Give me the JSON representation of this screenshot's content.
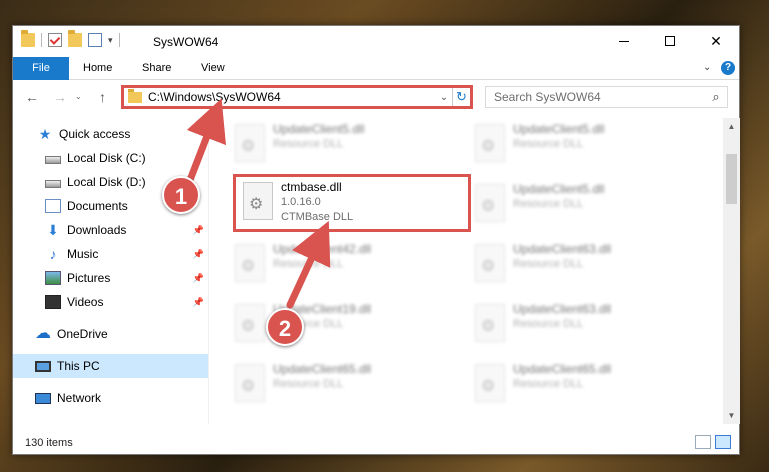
{
  "window": {
    "title": "SysWOW64",
    "qat_caret": "▾",
    "minimize": "",
    "maximize": "",
    "close": "✕"
  },
  "ribbon": {
    "tabs": [
      "File",
      "Home",
      "Share",
      "View"
    ],
    "expand": "⌄",
    "help": "?"
  },
  "nav": {
    "back": "←",
    "forward": "→",
    "recent": "⌄",
    "up": "↑",
    "address": "C:\\Windows\\SysWOW64",
    "address_dropdown": "⌄",
    "refresh": "↻",
    "search_placeholder": "Search SysWOW64",
    "search_icon": "⌕"
  },
  "sidebar": {
    "items": [
      {
        "label": "Quick access",
        "icon": "star-icon",
        "pinned": false
      },
      {
        "label": "Local Disk (C:)",
        "icon": "disk-icon",
        "pinned": false
      },
      {
        "label": "Local Disk (D:)",
        "icon": "disk-icon",
        "pinned": false
      },
      {
        "label": "Documents",
        "icon": "documents-icon",
        "pinned": false
      },
      {
        "label": "Downloads",
        "icon": "downloads-icon",
        "pinned": true
      },
      {
        "label": "Music",
        "icon": "music-icon",
        "pinned": true
      },
      {
        "label": "Pictures",
        "icon": "pictures-icon",
        "pinned": true
      },
      {
        "label": "Videos",
        "icon": "videos-icon",
        "pinned": true
      },
      {
        "label": "OneDrive",
        "icon": "onedrive-icon",
        "pinned": false
      },
      {
        "label": "This PC",
        "icon": "this-pc-icon",
        "pinned": false,
        "selected": true
      },
      {
        "label": "Network",
        "icon": "network-icon",
        "pinned": false
      }
    ],
    "pin_glyph": "📌"
  },
  "files": {
    "left": [
      {
        "name": "UpdateClient5.dll",
        "meta1": "Resource DLL",
        "meta2": ""
      },
      {
        "name": "ctmbase.dll",
        "meta1": "1.0.16.0",
        "meta2": "CTMBase DLL"
      },
      {
        "name": "UpdateClient42.dll",
        "meta1": "Resource DLL",
        "meta2": ""
      },
      {
        "name": "UpdateClient19.dll",
        "meta1": "Resource DLL",
        "meta2": ""
      },
      {
        "name": "UpdateClient65.dll",
        "meta1": "Resource DLL",
        "meta2": ""
      }
    ],
    "right": [
      {
        "name": "UpdateClient5.dll",
        "meta1": "Resource DLL"
      },
      {
        "name": "UpdateClient5.dll",
        "meta1": "Resource DLL"
      },
      {
        "name": "UpdateClient63.dll",
        "meta1": "Resource DLL"
      },
      {
        "name": "UpdateClient63.dll",
        "meta1": "Resource DLL"
      },
      {
        "name": "UpdateClient65.dll",
        "meta1": "Resource DLL"
      }
    ]
  },
  "status": {
    "item_count": "130 items"
  },
  "callouts": {
    "one": "1",
    "two": "2"
  },
  "colors": {
    "accent": "#1979ca",
    "highlight": "#d9534f",
    "selected": "#cce8ff"
  }
}
